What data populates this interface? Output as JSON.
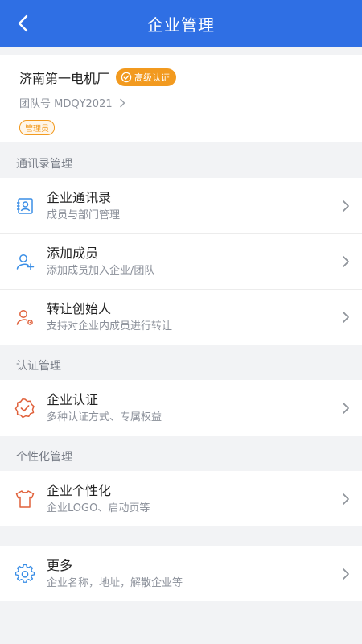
{
  "header": {
    "title": "企业管理"
  },
  "company": {
    "name": "济南第一电机厂",
    "cert_badge": "高级认证",
    "team_label": "团队号 MDQY2021",
    "role_tag": "管理员"
  },
  "sections": [
    {
      "title": "通讯录管理",
      "items": [
        {
          "title": "企业通讯录",
          "subtitle": "成员与部门管理",
          "icon": "contact-book-icon"
        },
        {
          "title": "添加成员",
          "subtitle": "添加成员加入企业/团队",
          "icon": "add-user-icon"
        },
        {
          "title": "转让创始人",
          "subtitle": "支持对企业内成员进行转让",
          "icon": "transfer-user-icon"
        }
      ]
    },
    {
      "title": "认证管理",
      "items": [
        {
          "title": "企业认证",
          "subtitle": "多种认证方式、专属权益",
          "icon": "certification-badge-icon"
        }
      ]
    },
    {
      "title": "个性化管理",
      "items": [
        {
          "title": "企业个性化",
          "subtitle": "企业LOGO、启动页等",
          "icon": "tshirt-icon"
        }
      ]
    },
    {
      "title": "",
      "items": [
        {
          "title": "更多",
          "subtitle": "企业名称，地址，解散企业等",
          "icon": "gear-icon"
        }
      ]
    }
  ],
  "colors": {
    "primary": "#2f6fe4",
    "accent_orange": "#f29a1f",
    "icon_blue": "#3a8ee6",
    "icon_red": "#e0603a"
  }
}
